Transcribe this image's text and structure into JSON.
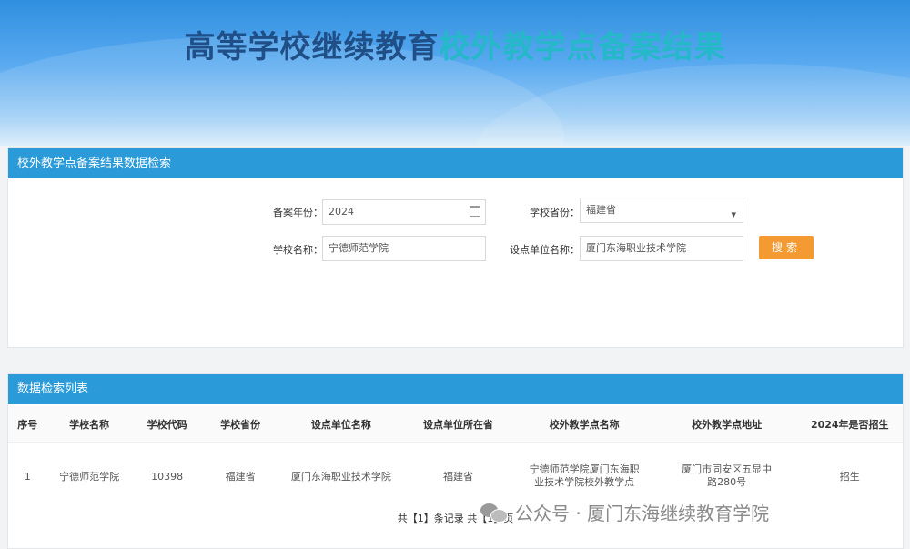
{
  "banner": {
    "title_part1": "高等学校继续教育",
    "title_part2": "校外教学点备案结果"
  },
  "search_panel": {
    "header": "校外教学点备案结果数据检索",
    "fields": {
      "year_label": "备案年份：",
      "year_value": "2024",
      "province_label": "学校省份：",
      "province_value": "福建省",
      "school_label": "学校名称：",
      "school_value": "宁德师范学院",
      "unit_label": "设点单位名称：",
      "unit_value": "厦门东海职业技术学院"
    },
    "search_button": "搜索"
  },
  "list_panel": {
    "header": "数据检索列表",
    "columns": [
      "序号",
      "学校名称",
      "学校代码",
      "学校省份",
      "设点单位名称",
      "设点单位所在省",
      "校外教学点名称",
      "校外教学点地址",
      "2024年是否招生"
    ],
    "rows": [
      [
        "1",
        "宁德师范学院",
        "10398",
        "福建省",
        "厦门东海职业技术学院",
        "福建省",
        "宁德师范学院厦门东海职业技术学院校外教学点",
        "厦门市同安区五显中路280号",
        "招生"
      ]
    ],
    "pager": "共【1】条记录 共【1】页"
  },
  "watermark": {
    "text": "公众号 · 厦门东海继续教育学院",
    "icon": "wechat-icon"
  }
}
